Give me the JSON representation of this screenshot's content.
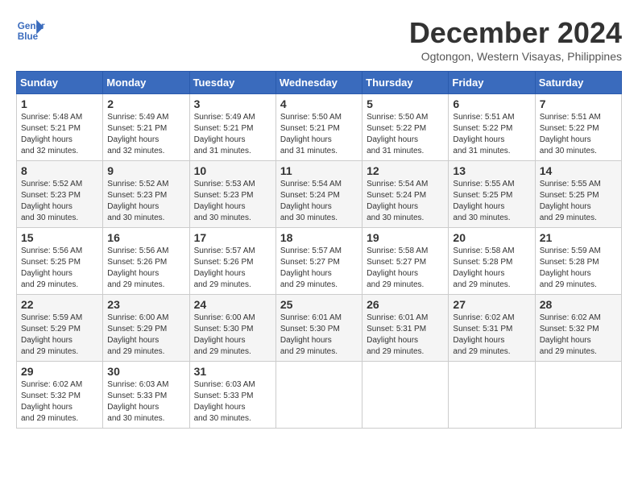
{
  "header": {
    "logo_line1": "General",
    "logo_line2": "Blue",
    "month": "December 2024",
    "location": "Ogtongon, Western Visayas, Philippines"
  },
  "weekdays": [
    "Sunday",
    "Monday",
    "Tuesday",
    "Wednesday",
    "Thursday",
    "Friday",
    "Saturday"
  ],
  "weeks": [
    [
      {
        "day": "1",
        "sunrise": "5:48 AM",
        "sunset": "5:21 PM",
        "daylight": "11 hours and 32 minutes."
      },
      {
        "day": "2",
        "sunrise": "5:49 AM",
        "sunset": "5:21 PM",
        "daylight": "11 hours and 32 minutes."
      },
      {
        "day": "3",
        "sunrise": "5:49 AM",
        "sunset": "5:21 PM",
        "daylight": "11 hours and 31 minutes."
      },
      {
        "day": "4",
        "sunrise": "5:50 AM",
        "sunset": "5:21 PM",
        "daylight": "11 hours and 31 minutes."
      },
      {
        "day": "5",
        "sunrise": "5:50 AM",
        "sunset": "5:22 PM",
        "daylight": "11 hours and 31 minutes."
      },
      {
        "day": "6",
        "sunrise": "5:51 AM",
        "sunset": "5:22 PM",
        "daylight": "11 hours and 31 minutes."
      },
      {
        "day": "7",
        "sunrise": "5:51 AM",
        "sunset": "5:22 PM",
        "daylight": "11 hours and 30 minutes."
      }
    ],
    [
      {
        "day": "8",
        "sunrise": "5:52 AM",
        "sunset": "5:23 PM",
        "daylight": "11 hours and 30 minutes."
      },
      {
        "day": "9",
        "sunrise": "5:52 AM",
        "sunset": "5:23 PM",
        "daylight": "11 hours and 30 minutes."
      },
      {
        "day": "10",
        "sunrise": "5:53 AM",
        "sunset": "5:23 PM",
        "daylight": "11 hours and 30 minutes."
      },
      {
        "day": "11",
        "sunrise": "5:54 AM",
        "sunset": "5:24 PM",
        "daylight": "11 hours and 30 minutes."
      },
      {
        "day": "12",
        "sunrise": "5:54 AM",
        "sunset": "5:24 PM",
        "daylight": "11 hours and 30 minutes."
      },
      {
        "day": "13",
        "sunrise": "5:55 AM",
        "sunset": "5:25 PM",
        "daylight": "11 hours and 30 minutes."
      },
      {
        "day": "14",
        "sunrise": "5:55 AM",
        "sunset": "5:25 PM",
        "daylight": "11 hours and 29 minutes."
      }
    ],
    [
      {
        "day": "15",
        "sunrise": "5:56 AM",
        "sunset": "5:25 PM",
        "daylight": "11 hours and 29 minutes."
      },
      {
        "day": "16",
        "sunrise": "5:56 AM",
        "sunset": "5:26 PM",
        "daylight": "11 hours and 29 minutes."
      },
      {
        "day": "17",
        "sunrise": "5:57 AM",
        "sunset": "5:26 PM",
        "daylight": "11 hours and 29 minutes."
      },
      {
        "day": "18",
        "sunrise": "5:57 AM",
        "sunset": "5:27 PM",
        "daylight": "11 hours and 29 minutes."
      },
      {
        "day": "19",
        "sunrise": "5:58 AM",
        "sunset": "5:27 PM",
        "daylight": "11 hours and 29 minutes."
      },
      {
        "day": "20",
        "sunrise": "5:58 AM",
        "sunset": "5:28 PM",
        "daylight": "11 hours and 29 minutes."
      },
      {
        "day": "21",
        "sunrise": "5:59 AM",
        "sunset": "5:28 PM",
        "daylight": "11 hours and 29 minutes."
      }
    ],
    [
      {
        "day": "22",
        "sunrise": "5:59 AM",
        "sunset": "5:29 PM",
        "daylight": "11 hours and 29 minutes."
      },
      {
        "day": "23",
        "sunrise": "6:00 AM",
        "sunset": "5:29 PM",
        "daylight": "11 hours and 29 minutes."
      },
      {
        "day": "24",
        "sunrise": "6:00 AM",
        "sunset": "5:30 PM",
        "daylight": "11 hours and 29 minutes."
      },
      {
        "day": "25",
        "sunrise": "6:01 AM",
        "sunset": "5:30 PM",
        "daylight": "11 hours and 29 minutes."
      },
      {
        "day": "26",
        "sunrise": "6:01 AM",
        "sunset": "5:31 PM",
        "daylight": "11 hours and 29 minutes."
      },
      {
        "day": "27",
        "sunrise": "6:02 AM",
        "sunset": "5:31 PM",
        "daylight": "11 hours and 29 minutes."
      },
      {
        "day": "28",
        "sunrise": "6:02 AM",
        "sunset": "5:32 PM",
        "daylight": "11 hours and 29 minutes."
      }
    ],
    [
      {
        "day": "29",
        "sunrise": "6:02 AM",
        "sunset": "5:32 PM",
        "daylight": "11 hours and 29 minutes."
      },
      {
        "day": "30",
        "sunrise": "6:03 AM",
        "sunset": "5:33 PM",
        "daylight": "11 hours and 30 minutes."
      },
      {
        "day": "31",
        "sunrise": "6:03 AM",
        "sunset": "5:33 PM",
        "daylight": "11 hours and 30 minutes."
      },
      null,
      null,
      null,
      null
    ]
  ]
}
